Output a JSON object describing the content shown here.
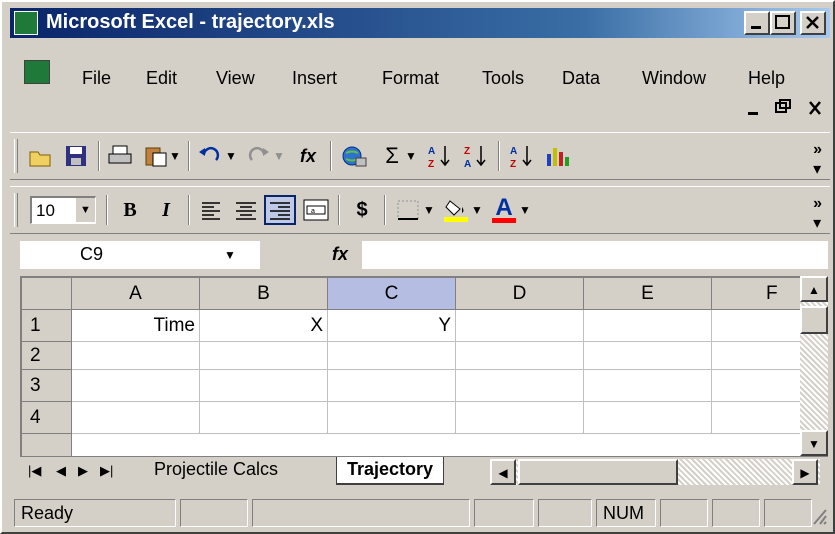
{
  "window": {
    "title": "Microsoft Excel - trajectory.xls"
  },
  "menu": {
    "items": [
      "File",
      "Edit",
      "View",
      "Insert",
      "Format",
      "Tools",
      "Data",
      "Window",
      "Help"
    ],
    "doc_controls": "_ ▫ ✕"
  },
  "toolbar": {
    "standard_icons": [
      "open-icon",
      "save-icon",
      "print-icon",
      "paste-icon",
      "undo-icon",
      "redo-icon",
      "insert-function-icon",
      "hyperlink-icon",
      "autosum-icon",
      "sort-ascending-icon",
      "sort-descending-icon",
      "sort-az-icon",
      "chart-wizard-icon"
    ],
    "font_size": "10",
    "format_icons": [
      "bold-icon",
      "italic-icon",
      "align-left-icon",
      "align-center-icon",
      "align-right-icon",
      "merge-center-icon",
      "currency-icon",
      "borders-icon",
      "fill-color-icon",
      "font-color-icon"
    ],
    "bold": "B",
    "italic": "I",
    "currency": "$",
    "font_color_letter": "A",
    "sigma": "Σ",
    "fx": "fx"
  },
  "formula_bar": {
    "name_box": "C9",
    "fx_label": "fx",
    "content": ""
  },
  "grid": {
    "columns": [
      "A",
      "B",
      "C",
      "D",
      "E",
      "F"
    ],
    "selected_column": "C",
    "rows": [
      {
        "num": "1",
        "cells": [
          "Time",
          "X",
          "Y",
          "",
          "",
          ""
        ]
      },
      {
        "num": "2",
        "cells": [
          "",
          "",
          "",
          "",
          "",
          ""
        ]
      },
      {
        "num": "3",
        "cells": [
          "",
          "",
          "",
          "",
          "",
          ""
        ]
      },
      {
        "num": "4",
        "cells": [
          "",
          "",
          "",
          "",
          "",
          ""
        ]
      }
    ]
  },
  "sheets": {
    "tabs": [
      "Projectile Calcs",
      "Trajectory"
    ],
    "active": "Trajectory"
  },
  "status": {
    "left": "Ready",
    "num": "NUM"
  },
  "colors": {
    "title_active": "#0a246a",
    "selected_header": "#b6bde3",
    "chrome": "#d4d0c8",
    "fill_yellow": "#ffff00",
    "font_red": "#ff0000"
  }
}
